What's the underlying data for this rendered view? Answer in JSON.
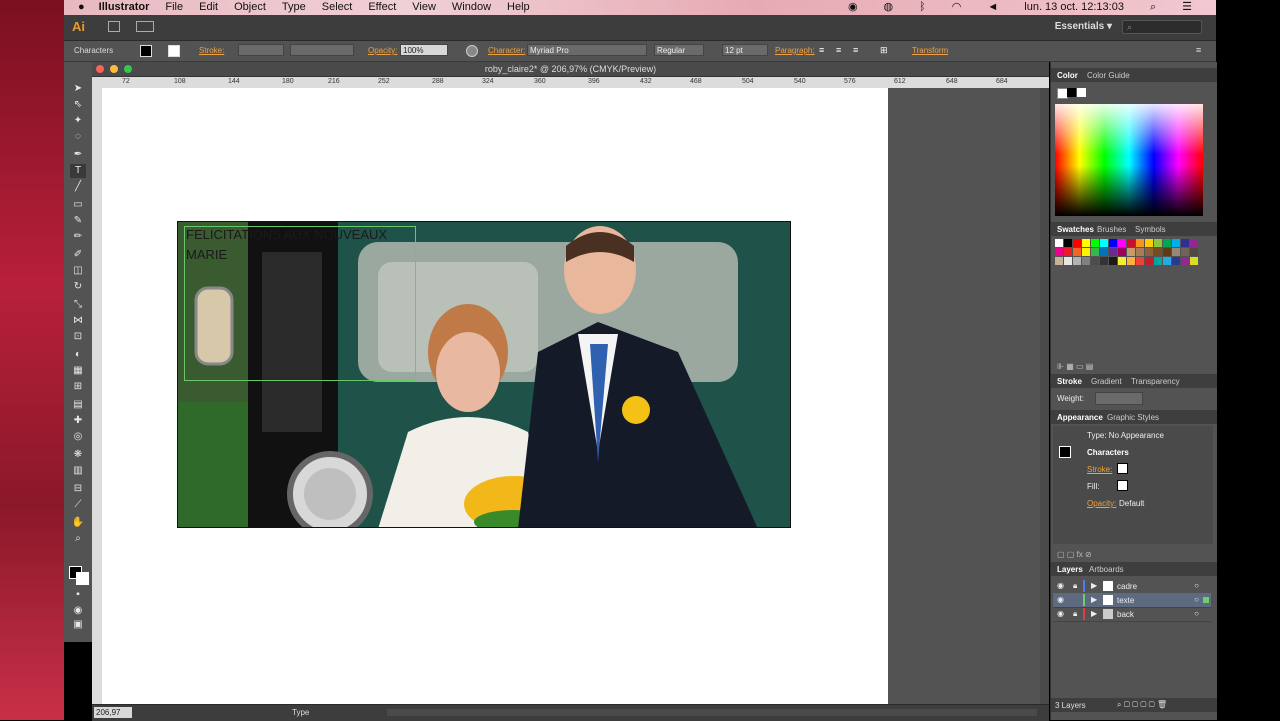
{
  "menubar": {
    "apple": "",
    "app": "Illustrator",
    "items": [
      "File",
      "Edit",
      "Object",
      "Type",
      "Select",
      "Effect",
      "View",
      "Window",
      "Help"
    ],
    "clock": "lun. 13 oct.  12:13:03"
  },
  "appbar": {
    "logo": "Ai",
    "workspace": "Essentials",
    "workspace_arrow": "▾"
  },
  "control": {
    "selection": "Characters",
    "stroke_label": "Stroke:",
    "opacity_label": "Opacity:",
    "opacity_value": "100%",
    "character_label": "Character:",
    "font": "Myriad Pro",
    "style": "Regular",
    "size": "12 pt",
    "paragraph_label": "Paragraph:",
    "transform_label": "Transform"
  },
  "document": {
    "title": "roby_claire2* @ 206,97% (CMYK/Preview)",
    "ruler_ticks": [
      "72",
      "108",
      "144",
      "180",
      "216",
      "252",
      "288",
      "324",
      "360",
      "396",
      "432",
      "468",
      "504",
      "540",
      "576",
      "612",
      "648",
      "684"
    ],
    "photo_text_line1": "FELICITATIONS AUX NOUVEAUX",
    "photo_text_line2": "MARIE",
    "zoom": "206,97",
    "status_tool": "Type"
  },
  "panels": {
    "color": {
      "tab1": "Color",
      "tab2": "Color Guide"
    },
    "swatches": {
      "tab1": "Swatches",
      "tab2": "Brushes",
      "tab3": "Symbols"
    },
    "stroke": {
      "tab1": "Stroke",
      "tab2": "Gradient",
      "tab3": "Transparency",
      "weight_label": "Weight:"
    },
    "appearance": {
      "tab1": "Appearance",
      "tab2": "Graphic Styles",
      "type_line": "Type: No Appearance",
      "title": "Characters",
      "stroke": "Stroke:",
      "fill": "Fill:",
      "opacity": "Opacity:",
      "opacity_value": "Default"
    },
    "layers": {
      "tab1": "Layers",
      "tab2": "Artboards",
      "items": [
        {
          "name": "cadre",
          "color": "#4f7bff"
        },
        {
          "name": "texte",
          "color": "#6ad06a"
        },
        {
          "name": "back",
          "color": "#e04040"
        }
      ],
      "count": "3 Layers"
    }
  },
  "colors": {
    "accent": "#f0a040",
    "panel_bg": "#535353",
    "text_frame": "#68c76a"
  }
}
